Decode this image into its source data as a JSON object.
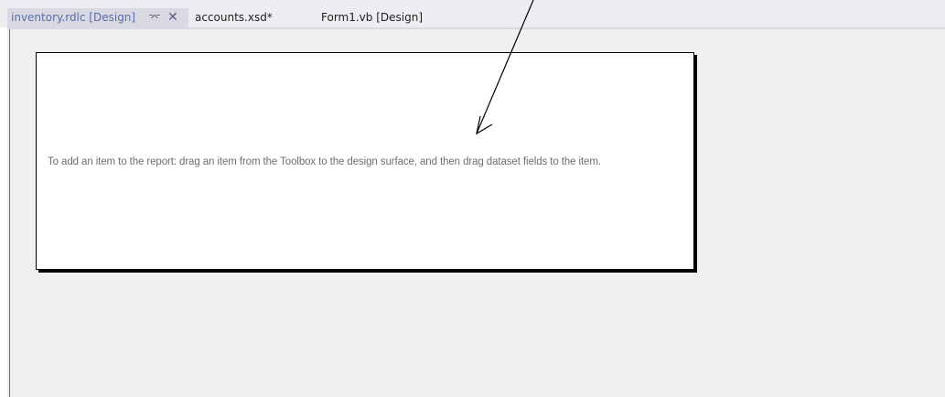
{
  "tabs": {
    "active_label": "inventory.rdlc [Design]",
    "pin_glyph": "⌤",
    "close_glyph": "✕",
    "tab2_label": "accounts.xsd*",
    "tab3_label": "Form1.vb [Design]"
  },
  "designer": {
    "hint_text": "To add an item to the report: drag an item from the Toolbox to the design surface, and then drag dataset fields to the item."
  },
  "colors": {
    "active_tab_text": "#5b6cab",
    "designer_background": "#f0f0f0",
    "annotation_arrow": "#000000"
  }
}
